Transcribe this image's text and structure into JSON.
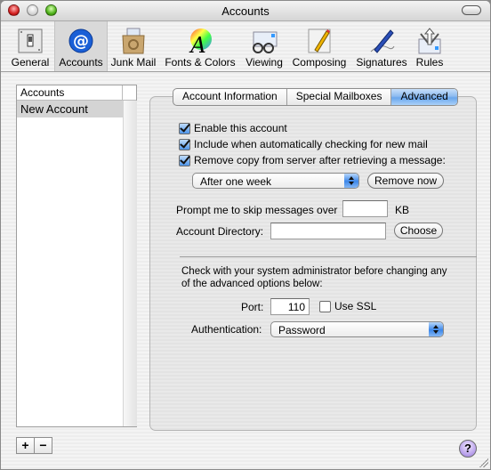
{
  "window": {
    "title": "Accounts"
  },
  "toolbar": {
    "items": [
      {
        "label": "General",
        "icon": "light-switch-icon"
      },
      {
        "label": "Accounts",
        "icon": "at-sign-icon",
        "selected": true
      },
      {
        "label": "Junk Mail",
        "icon": "recycle-box-icon"
      },
      {
        "label": "Fonts & Colors",
        "icon": "color-wheel-font-icon"
      },
      {
        "label": "Viewing",
        "icon": "glasses-icon"
      },
      {
        "label": "Composing",
        "icon": "pencil-paper-icon"
      },
      {
        "label": "Signatures",
        "icon": "pen-signature-icon"
      },
      {
        "label": "Rules",
        "icon": "rules-arrows-icon"
      }
    ]
  },
  "accounts_list": {
    "header": "Accounts",
    "items": [
      "New Account"
    ],
    "add_label": "+",
    "remove_label": "−"
  },
  "tabs": [
    {
      "label": "Account Information",
      "active": false
    },
    {
      "label": "Special Mailboxes",
      "active": false
    },
    {
      "label": "Advanced",
      "active": true
    }
  ],
  "advanced": {
    "enable_account": {
      "label": "Enable this account",
      "checked": true
    },
    "include_auto_check": {
      "label": "Include when automatically checking for new mail",
      "checked": true
    },
    "remove_copy": {
      "label": "Remove copy from server after retrieving a message:",
      "checked": true
    },
    "remove_after": {
      "value": "After one week"
    },
    "remove_now_label": "Remove now",
    "skip_prompt_label": "Prompt me to skip messages over",
    "skip_size_value": "",
    "skip_unit": "KB",
    "account_directory_label": "Account Directory:",
    "account_directory_value": "",
    "choose_label": "Choose",
    "admin_note": "Check with your system administrator before changing any of the advanced options below:",
    "port_label": "Port:",
    "port_value": "110",
    "use_ssl": {
      "label": "Use SSL",
      "checked": false
    },
    "authentication_label": "Authentication:",
    "authentication_value": "Password"
  },
  "help_label": "?",
  "colors": {
    "accent_blue": "#6aa6ec",
    "selection_gray": "#d4d4d4"
  }
}
